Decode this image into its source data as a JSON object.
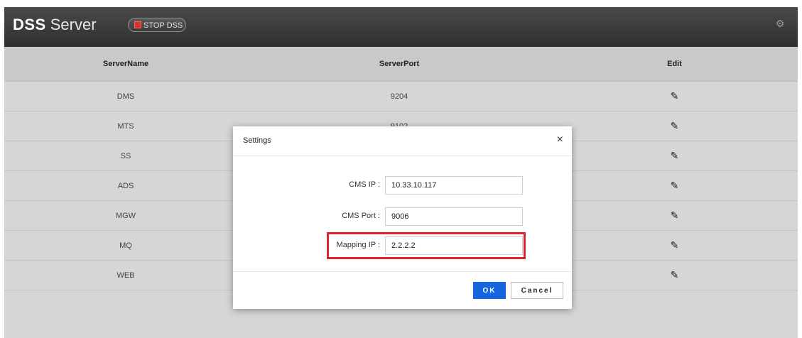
{
  "header": {
    "brand_strong": "DSS",
    "brand_light": "Server",
    "stop_button_label": "STOP DSS",
    "settings_icon": "gear-icon"
  },
  "table": {
    "columns": [
      "ServerName",
      "ServerPort",
      "Edit"
    ],
    "rows": [
      {
        "name": "DMS",
        "port": "9204"
      },
      {
        "name": "MTS",
        "port": "9102"
      },
      {
        "name": "SS",
        "port": ""
      },
      {
        "name": "ADS",
        "port": ""
      },
      {
        "name": "MGW",
        "port": ""
      },
      {
        "name": "MQ",
        "port": ""
      },
      {
        "name": "WEB",
        "port": ""
      }
    ],
    "edit_icon": "pencil-icon"
  },
  "modal": {
    "title": "Settings",
    "close_glyph": "×",
    "fields": [
      {
        "label": "CMS IP :",
        "value": "10.33.10.117"
      },
      {
        "label": "CMS Port :",
        "value": "9006"
      },
      {
        "label": "Mapping IP :",
        "value": "2.2.2.2"
      }
    ],
    "ok_label": "OK",
    "cancel_label": "Cancel"
  },
  "colors": {
    "primary_button": "#1565e0",
    "highlight_border": "#e02231",
    "stop_indicator": "#d9322b"
  }
}
